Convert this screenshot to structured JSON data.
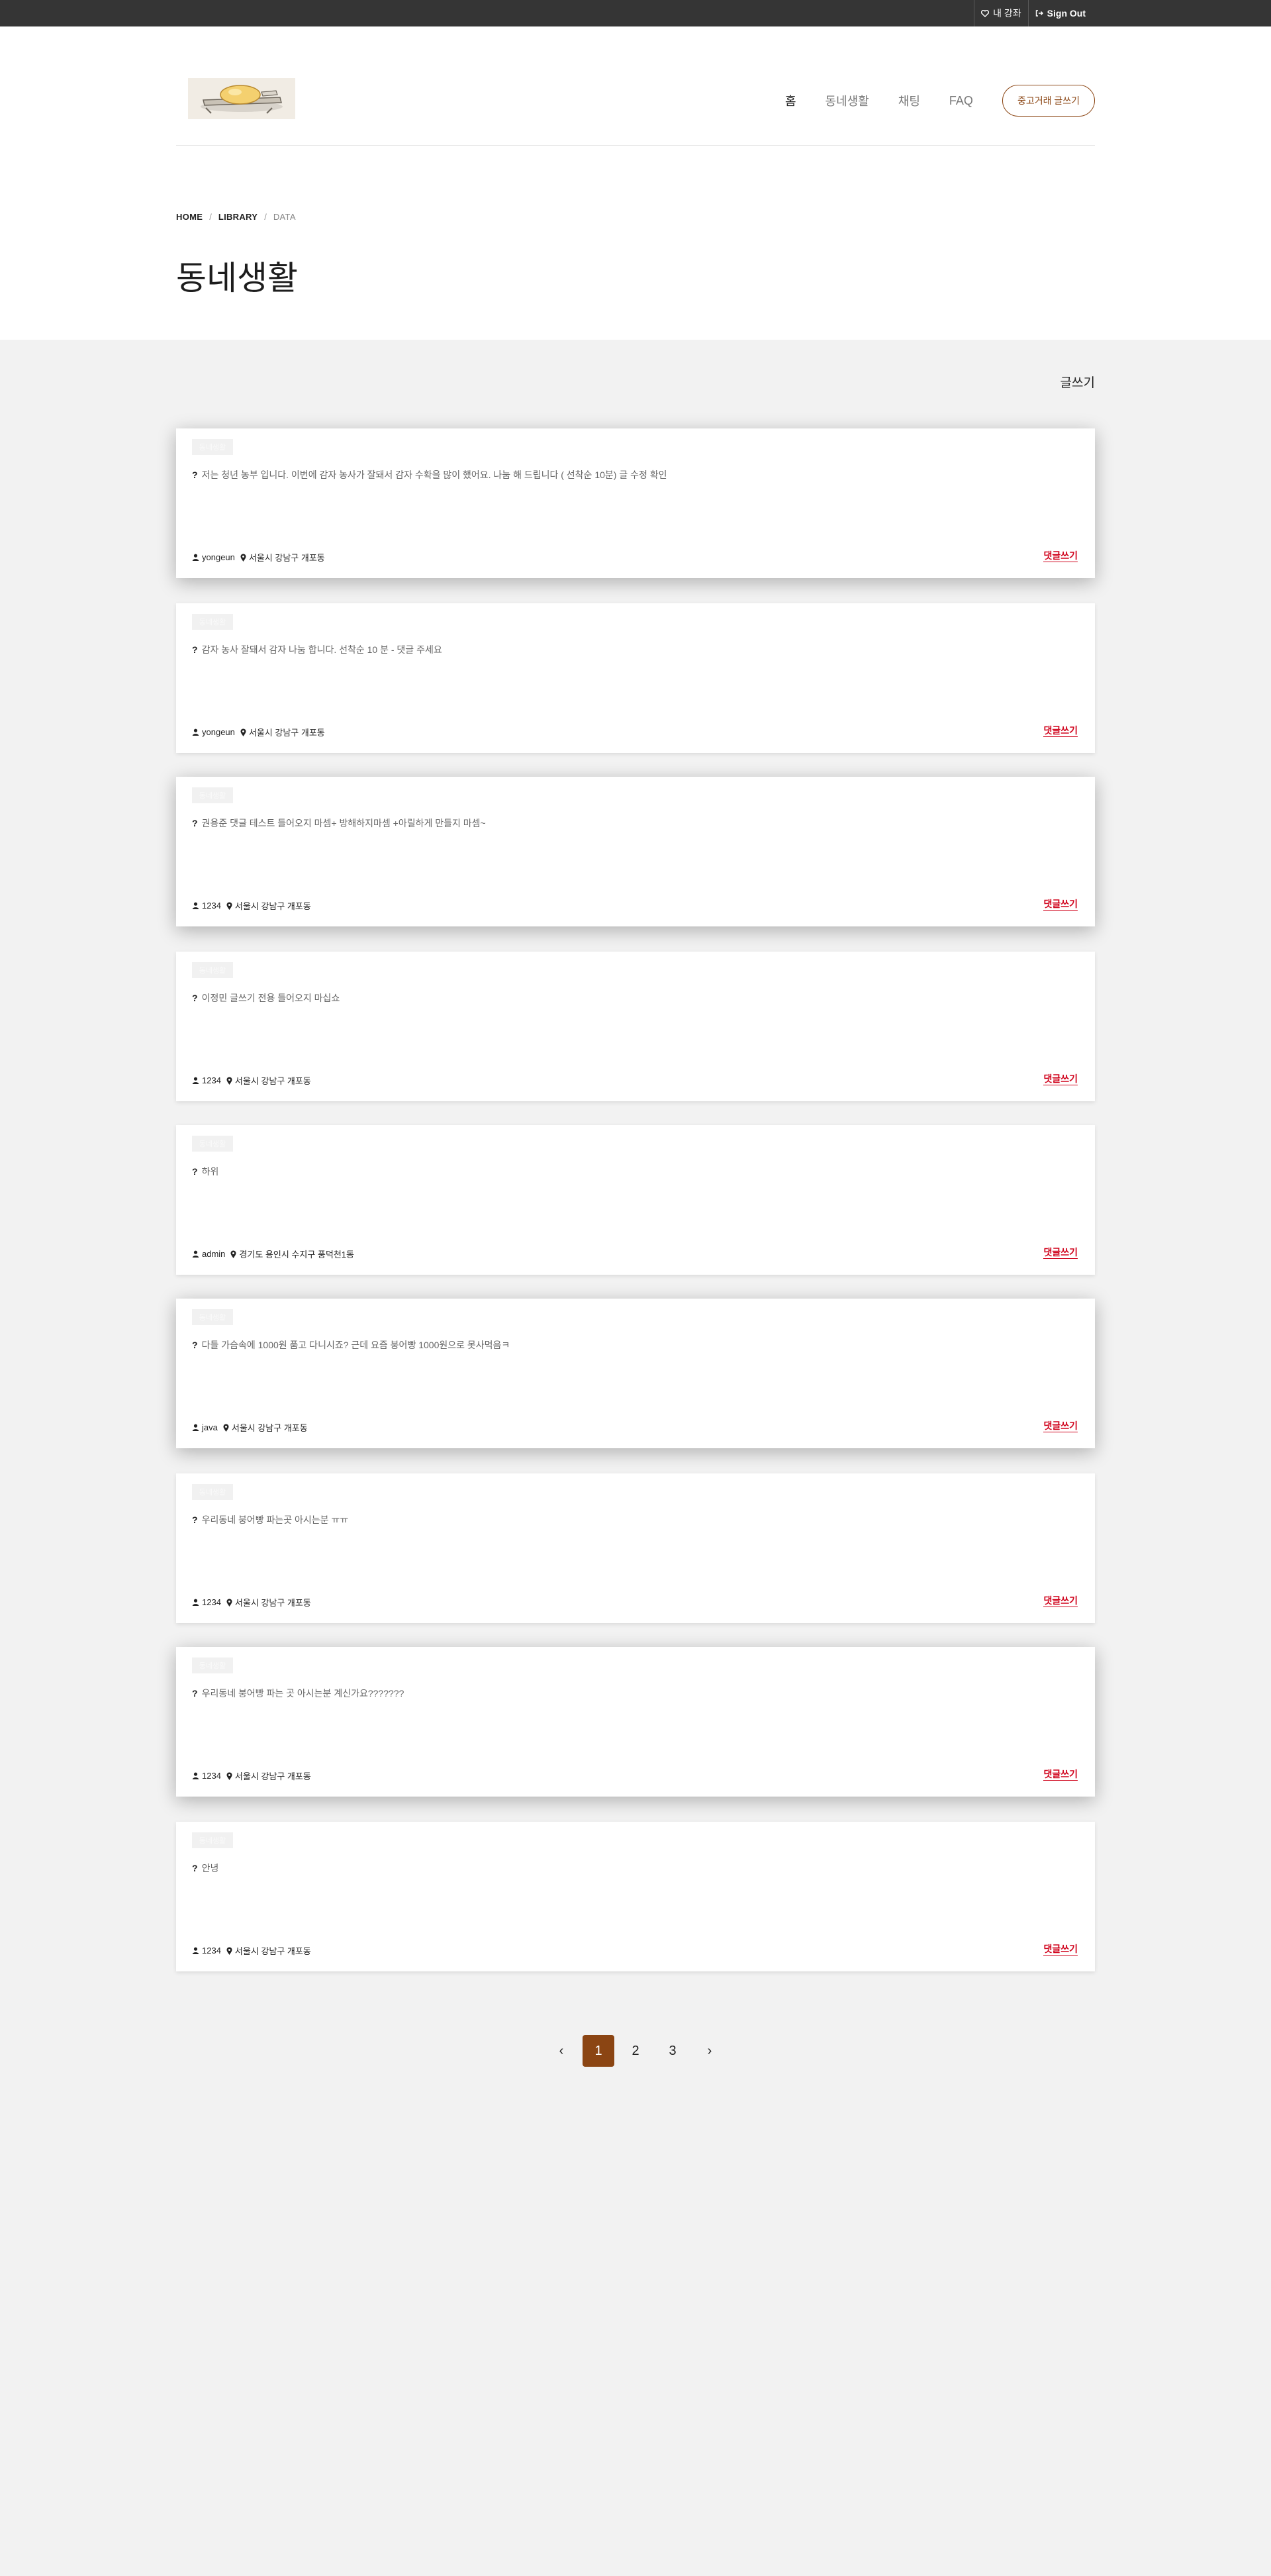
{
  "topbar": {
    "my_lecture": "내 강좌",
    "sign_out": "Sign Out"
  },
  "nav": {
    "items": [
      "홈",
      "동네생활",
      "채팅",
      "FAQ"
    ],
    "cta": "중고거래 글쓰기"
  },
  "breadcrumb": {
    "home": "HOME",
    "library": "LIBRARY",
    "data": "DATA",
    "sep": "/"
  },
  "page_title": "동네생활",
  "write_label": "글쓰기",
  "posts": [
    {
      "tag": "동네생활",
      "text": "저는 청년 농부 입니다. 이번에 감자 농사가 잘돼서 감자 수확을 많이 했어요. 나눔 해 드립니다 ( 선착순 10분) 글 수정 확인",
      "user": "yongeun",
      "location": "서울시 강남구 개포동",
      "comment": "댓글쓰기"
    },
    {
      "tag": "동네생활",
      "text": "감자 농사 잘돼서 감자 나눔 합니다. 선착순 10 분 - 댓글 주세요",
      "user": "yongeun",
      "location": "서울시 강남구 개포동",
      "comment": "댓글쓰기"
    },
    {
      "tag": "동네생활",
      "text": "권용준 댓글 테스트 들어오지 마셈+ 방해하지마셈 +아릴하게 만들지 마셈~",
      "user": "1234",
      "location": "서울시 강남구 개포동",
      "comment": "댓글쓰기"
    },
    {
      "tag": "동네생활",
      "text": "이정민 글쓰기 전용 들어오지 마십쇼",
      "user": "1234",
      "location": "서울시 강남구 개포동",
      "comment": "댓글쓰기"
    },
    {
      "tag": "동네생활",
      "text": "하위",
      "user": "admin",
      "location": "경기도 용인시 수지구 풍덕천1동",
      "comment": "댓글쓰기"
    },
    {
      "tag": "동네생활",
      "text": "다들 가슴속에 1000원 품고 다니시죠? 근데 요즘 붕어빵 1000원으로 못사먹음ㅋ",
      "user": "java",
      "location": "서울시 강남구 개포동",
      "comment": "댓글쓰기"
    },
    {
      "tag": "동네생활",
      "text": "우리동네 붕어빵 파는곳 아시는분 ㅠㅠ",
      "user": "1234",
      "location": "서울시 강남구 개포동",
      "comment": "댓글쓰기"
    },
    {
      "tag": "동네생활",
      "text": "우리동네 붕어빵 파는 곳 아시는분 계신가요???????",
      "user": "1234",
      "location": "서울시 강남구 개포동",
      "comment": "댓글쓰기"
    },
    {
      "tag": "동네생활",
      "text": "안녕",
      "user": "1234",
      "location": "서울시 강남구 개포동",
      "comment": "댓글쓰기"
    }
  ],
  "pagination": {
    "prev": "‹",
    "pages": [
      "1",
      "2",
      "3"
    ],
    "current": "1",
    "next": "›"
  },
  "colors": {
    "topbar": "#353535",
    "accent": "#8b4513",
    "comment": "#d0021b",
    "background": "#f2f2f2"
  }
}
